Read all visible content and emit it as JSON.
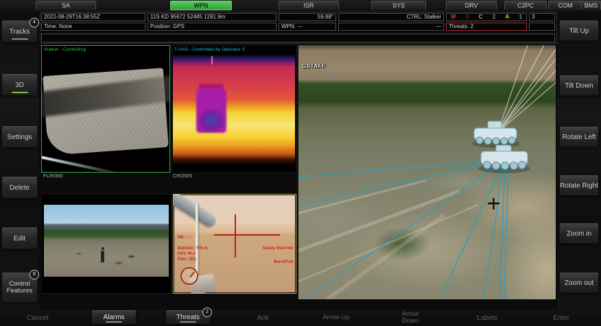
{
  "tabs": [
    {
      "label": "SA"
    },
    {
      "label": "WPN"
    },
    {
      "label": "ISR"
    },
    {
      "label": "SYS"
    },
    {
      "label": "DRV"
    },
    {
      "label": "C2PC"
    },
    {
      "label": "COM"
    },
    {
      "label": "BMS"
    }
  ],
  "status": {
    "timestamp": "2022-08-29T16:38:55Z",
    "coordinates": "11S KD 95672 52485 1291.9m",
    "heading": "59.88°",
    "control": "CTRL: Stalker",
    "alerts": {
      "w_label": "W",
      "w_value": "0",
      "c_label": "C",
      "c_value": "2",
      "a_label": "A",
      "a_value": "1"
    },
    "count": "3",
    "time": "Time: None",
    "position": "Position: GPS",
    "weapon": "WPN: ---",
    "dashes": "---",
    "threats": "Threats: 2"
  },
  "left_sidebar": {
    "items": [
      {
        "label": "Tracks",
        "badge": "4"
      },
      {
        "label": "3D"
      },
      {
        "label": "Settings"
      },
      {
        "label": "Delete"
      },
      {
        "label": "Edit"
      },
      {
        "label": "Control Features",
        "badge": "8"
      }
    ]
  },
  "right_sidebar": {
    "items": [
      {
        "label": "Tilt Up"
      },
      {
        "label": "Tilt Down"
      },
      {
        "label": "Rotate Left"
      },
      {
        "label": "Rotate Right"
      },
      {
        "label": "Zoom in"
      },
      {
        "label": "Zoom out"
      }
    ]
  },
  "bottom_bar": {
    "cancel": "Cancel",
    "alarms": "Alarms",
    "threats": "Threats",
    "threats_badge": "2",
    "ack": "Ack",
    "arrow_up": "Arrow Up",
    "arrow_down": "Arrow Down",
    "labels": "Labels",
    "enter": "Enter"
  },
  "feeds": {
    "flir": {
      "status_label": "Stalker - Controlling",
      "caption": "FLIR380"
    },
    "tuas": {
      "status_label": "T-UAS - Controlled by Operator 3",
      "caption": "CROWS"
    },
    "gun_hud": {
      "mil": "MIL: ---",
      "ballistic": "Ballistic: 700 m",
      "fov": "FOV 40.4",
      "elev": "Elev: 0(0)",
      "safety": "Safety Override",
      "burst": "Burst/Full"
    }
  },
  "map": {
    "place_label": "GSTAFF"
  },
  "colors": {
    "accent_green": "#3fc24a",
    "alert_red": "#a83232",
    "warn_orange": "#e8a33d",
    "warn_yellow": "#d6d62e",
    "feed_select_green": "#2fae3e",
    "feed_select_yellow": "#c8b440",
    "map_line_blue": "#2d9dbb"
  }
}
